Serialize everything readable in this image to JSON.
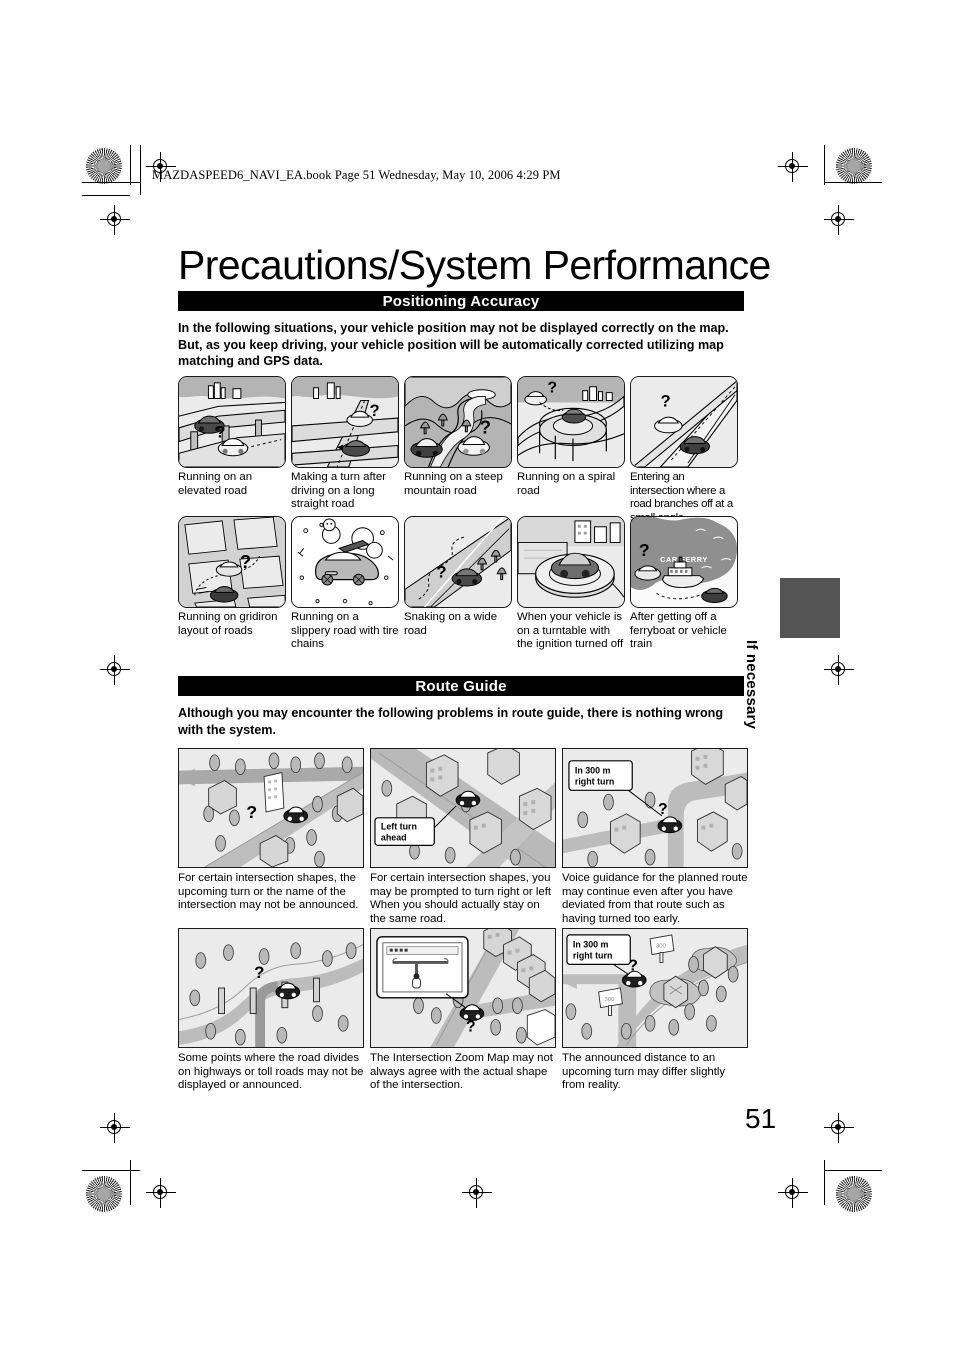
{
  "document": {
    "filestamp": "MAZDASPEED6_NAVI_EA.book  Page 51  Wednesday, May 10, 2006  4:29 PM",
    "title": "Precautions/System Performance",
    "page_number": "51",
    "side_tab": "If necessary"
  },
  "sections": [
    {
      "heading": "Positioning Accuracy",
      "lead": "In the following situations, your vehicle position may not be displayed correctly on the map. But, as you keep driving, your vehicle position will be automatically corrected utilizing map matching and GPS data.",
      "rows": [
        {
          "figures": [
            {
              "caption": "Running on an elevated road",
              "art": "elevated"
            },
            {
              "caption": "Making a turn after driving on a long straight road",
              "art": "longstraight"
            },
            {
              "caption": "Running on a steep mountain road",
              "art": "mountain"
            },
            {
              "caption": "Running on a spiral road",
              "art": "spiral"
            },
            {
              "caption": "Entering an intersection where a road branches off at a small angle",
              "art": "smallangle"
            }
          ]
        },
        {
          "figures": [
            {
              "caption": "Running on gridiron layout of roads",
              "art": "gridiron"
            },
            {
              "caption": "Running on a slippery road with tire chains",
              "art": "chains"
            },
            {
              "caption": "Snaking on a wide road",
              "art": "snaking"
            },
            {
              "caption": "When your vehicle is on a turntable with the ignition turned off",
              "art": "turntable"
            },
            {
              "caption": "After getting off a ferryboat or vehicle train",
              "art": "ferry",
              "label": "CAR FERRY"
            }
          ]
        }
      ]
    },
    {
      "heading": "Route Guide",
      "lead": "Although you may encounter the following problems in route guide, there is nothing wrong with the system.",
      "rows": [
        {
          "figures": [
            {
              "caption": "For certain intersection shapes, the upcoming turn or the name of the intersection may not be announced.",
              "art": "rg-diagonal"
            },
            {
              "caption": "For certain intersection shapes, you may be prompted to turn right or left When you should actually stay on the same road.",
              "art": "rg-leftturn",
              "label": "Left turn ahead"
            },
            {
              "caption": "Voice guidance for the planned route may continue even after you have deviated from that route such as having turned too early.",
              "art": "rg-deviate",
              "label": "In 300 m right turn"
            }
          ]
        },
        {
          "figures": [
            {
              "caption": "Some points where the road divides on highways or toll roads may not be displayed or announced.",
              "art": "rg-divide"
            },
            {
              "caption": "The Intersection Zoom Map may not always agree with the actual shape of the intersection.",
              "art": "rg-zoommap"
            },
            {
              "caption": "The announced distance to an upcoming turn may differ slightly from reality.",
              "art": "rg-distance",
              "label": "In 300 m right turn"
            }
          ]
        }
      ]
    }
  ],
  "colors": {
    "band_background": "#000000",
    "band_text": "#ffffff",
    "illustration_background": "#ebebeb",
    "illustration_mid": "#c8c8c8",
    "illustration_dark": "#8a8a8a",
    "side_tab": "#545454"
  }
}
